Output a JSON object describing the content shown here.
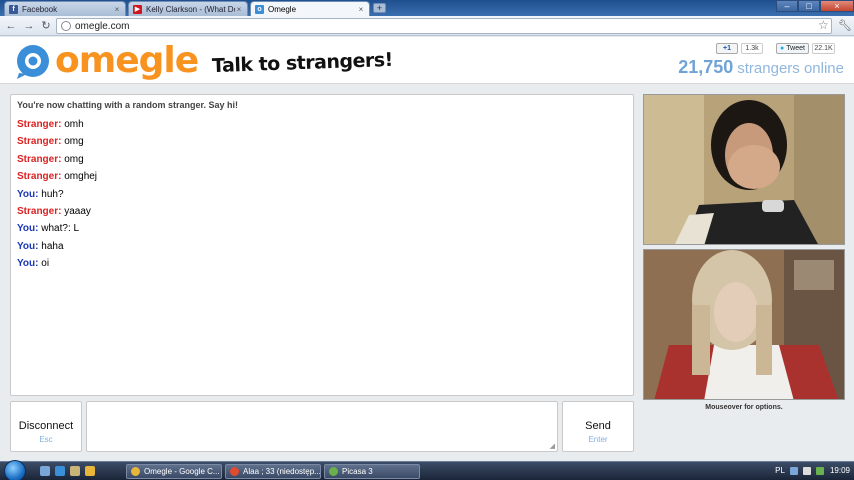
{
  "browser": {
    "tabs": [
      {
        "label": "Facebook",
        "favicon_color": "#3b5998",
        "favicon_glyph": "f",
        "active": false
      },
      {
        "label": "Kelly Clarkson - (What Doe",
        "favicon_color": "#cc181e",
        "favicon_glyph": "▶",
        "active": false
      },
      {
        "label": "Omegle",
        "favicon_color": "#3a8fd8",
        "favicon_glyph": "o",
        "active": true
      }
    ],
    "new_tab_glyph": "+",
    "address": "omegle.com"
  },
  "header": {
    "logo": "omegle",
    "tagline": "Talk to strangers!",
    "gplus_label": "+1",
    "gplus_count": "1.3k",
    "tweet_label": "Tweet",
    "tweet_count": "22.1K",
    "strangers_count": "21,750",
    "strangers_label": "strangers online",
    "brand_orange": "#f7931e",
    "brand_blue": "#3a8fd8"
  },
  "chat": {
    "status": "You're now chatting with a random stranger. Say hi!",
    "messages": [
      {
        "who": "Stranger:",
        "type": "stranger",
        "text": "omh"
      },
      {
        "who": "Stranger:",
        "type": "stranger",
        "text": "omg"
      },
      {
        "who": "Stranger:",
        "type": "stranger",
        "text": "omg"
      },
      {
        "who": "Stranger:",
        "type": "stranger",
        "text": "omghej"
      },
      {
        "who": "You:",
        "type": "you",
        "text": "huh?"
      },
      {
        "who": "Stranger:",
        "type": "stranger",
        "text": "yaaay"
      },
      {
        "who": "You:",
        "type": "you",
        "text": "what?: L"
      },
      {
        "who": "You:",
        "type": "you",
        "text": "haha"
      },
      {
        "who": "You:",
        "type": "you",
        "text": "oi"
      }
    ]
  },
  "controls": {
    "disconnect_label": "Disconnect",
    "disconnect_hint": "Esc",
    "send_label": "Send",
    "send_hint": "Enter",
    "message_value": ""
  },
  "video": {
    "mouseover_hint": "Mouseover for options."
  },
  "taskbar": {
    "tasks": [
      {
        "label": "Omegle - Google C...",
        "icon_color": "#e8b53b"
      },
      {
        "label": "Alaa ; 33 (niedostęp...",
        "icon_color": "#e04b2f"
      },
      {
        "label": "Picasa 3",
        "icon_color": "#6ab04c"
      }
    ],
    "language": "PL",
    "clock": "19:09"
  }
}
